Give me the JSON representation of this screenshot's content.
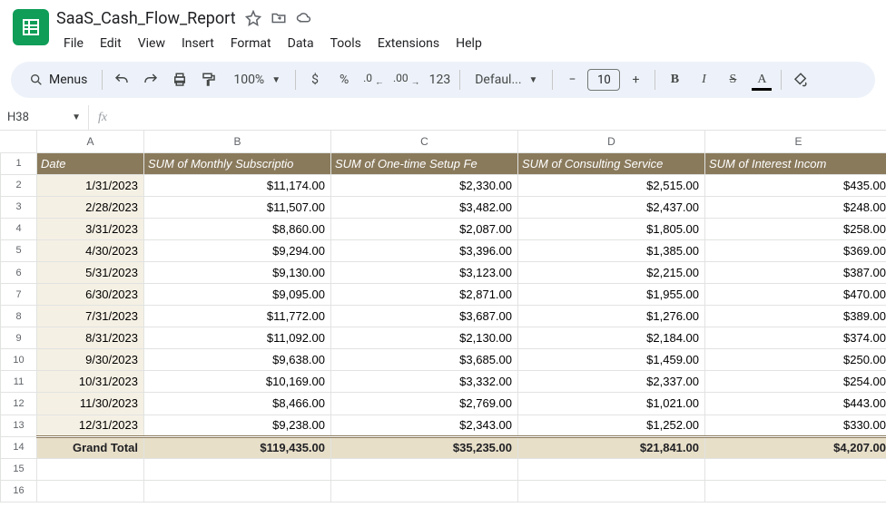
{
  "doc": {
    "title": "SaaS_Cash_Flow_Report"
  },
  "menus": [
    "File",
    "Edit",
    "View",
    "Insert",
    "Format",
    "Data",
    "Tools",
    "Extensions",
    "Help"
  ],
  "toolbar": {
    "menus_label": "Menus",
    "zoom": "100%",
    "font_name": "Defaul...",
    "font_size": "10"
  },
  "namebox": {
    "ref": "H38"
  },
  "columns_letters": [
    "A",
    "B",
    "C",
    "D",
    "E"
  ],
  "headers": {
    "A": "Date",
    "B": "SUM of Monthly Subscriptio",
    "C": "SUM of One-time Setup Fe",
    "D": "SUM of Consulting Service",
    "E": "SUM of Interest Incom"
  },
  "rows": [
    {
      "n": "2",
      "A": "1/31/2023",
      "B": "$11,174.00",
      "C": "$2,330.00",
      "D": "$2,515.00",
      "E": "$435.00"
    },
    {
      "n": "3",
      "A": "2/28/2023",
      "B": "$11,507.00",
      "C": "$3,482.00",
      "D": "$2,437.00",
      "E": "$248.00"
    },
    {
      "n": "4",
      "A": "3/31/2023",
      "B": "$8,860.00",
      "C": "$2,087.00",
      "D": "$1,805.00",
      "E": "$258.00"
    },
    {
      "n": "5",
      "A": "4/30/2023",
      "B": "$9,294.00",
      "C": "$3,396.00",
      "D": "$1,385.00",
      "E": "$369.00"
    },
    {
      "n": "6",
      "A": "5/31/2023",
      "B": "$9,130.00",
      "C": "$3,123.00",
      "D": "$2,215.00",
      "E": "$387.00"
    },
    {
      "n": "7",
      "A": "6/30/2023",
      "B": "$9,095.00",
      "C": "$2,871.00",
      "D": "$1,955.00",
      "E": "$470.00"
    },
    {
      "n": "8",
      "A": "7/31/2023",
      "B": "$11,772.00",
      "C": "$3,687.00",
      "D": "$1,276.00",
      "E": "$389.00"
    },
    {
      "n": "9",
      "A": "8/31/2023",
      "B": "$11,092.00",
      "C": "$2,130.00",
      "D": "$2,184.00",
      "E": "$374.00"
    },
    {
      "n": "10",
      "A": "9/30/2023",
      "B": "$9,638.00",
      "C": "$3,685.00",
      "D": "$1,459.00",
      "E": "$250.00"
    },
    {
      "n": "11",
      "A": "10/31/2023",
      "B": "$10,169.00",
      "C": "$3,332.00",
      "D": "$2,337.00",
      "E": "$254.00"
    },
    {
      "n": "12",
      "A": "11/30/2023",
      "B": "$8,466.00",
      "C": "$2,769.00",
      "D": "$1,021.00",
      "E": "$443.00"
    },
    {
      "n": "13",
      "A": "12/31/2023",
      "B": "$9,238.00",
      "C": "$2,343.00",
      "D": "$1,252.00",
      "E": "$330.00"
    }
  ],
  "total": {
    "n": "14",
    "A": "Grand Total",
    "B": "$119,435.00",
    "C": "$35,235.00",
    "D": "$21,841.00",
    "E": "$4,207.00"
  },
  "empty_rows": [
    "15",
    "16"
  ]
}
